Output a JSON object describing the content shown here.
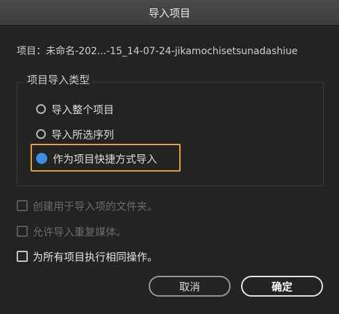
{
  "window": {
    "title": "导入项目"
  },
  "project": {
    "line": "项目：未命名-202...-15_14-07-24-jikamochisetsunadashiue"
  },
  "import_type": {
    "title": "项目导入类型",
    "options": [
      {
        "label": "导入整个项目",
        "selected": false
      },
      {
        "label": "导入所选序列",
        "selected": false
      },
      {
        "label": "作为项目快捷方式导入",
        "selected": true
      }
    ]
  },
  "checkboxes": [
    {
      "label": "创建用于导入项的文件夹。",
      "checked": false,
      "enabled": false
    },
    {
      "label": "允许导入重复媒体。",
      "checked": false,
      "enabled": false
    },
    {
      "label": "为所有项目执行相同操作。",
      "checked": false,
      "enabled": true
    }
  ],
  "buttons": {
    "cancel": "取消",
    "ok": "确定"
  },
  "colors": {
    "background": "#232323",
    "accent_radio": "#3d8ee6",
    "focus_ring": "#e8a23a"
  }
}
